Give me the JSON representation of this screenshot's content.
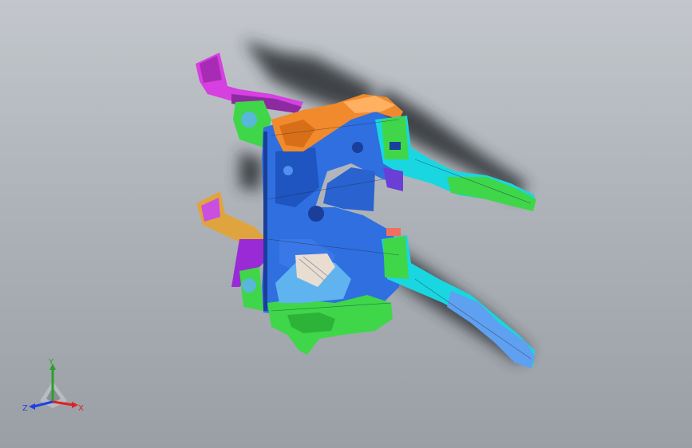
{
  "viewport": {
    "background_top": "#c3c7cc",
    "background_bottom": "#9a9fa6"
  },
  "model": {
    "colors": {
      "blue_panel": "#2f6fe0",
      "orange_bracket": "#f08a2c",
      "green_part": "#3fd64a",
      "cyan_rail": "#1ad6e0",
      "magenta_beam": "#d63fe0",
      "light_blue": "#5fb4f0",
      "dark_shadow": "#2b2e33"
    }
  },
  "triad": {
    "y_label": "Y",
    "x_label": "X",
    "z_label": "Z",
    "x_color": "#e02020",
    "y_color": "#2aa02a",
    "z_color": "#2040e0"
  }
}
